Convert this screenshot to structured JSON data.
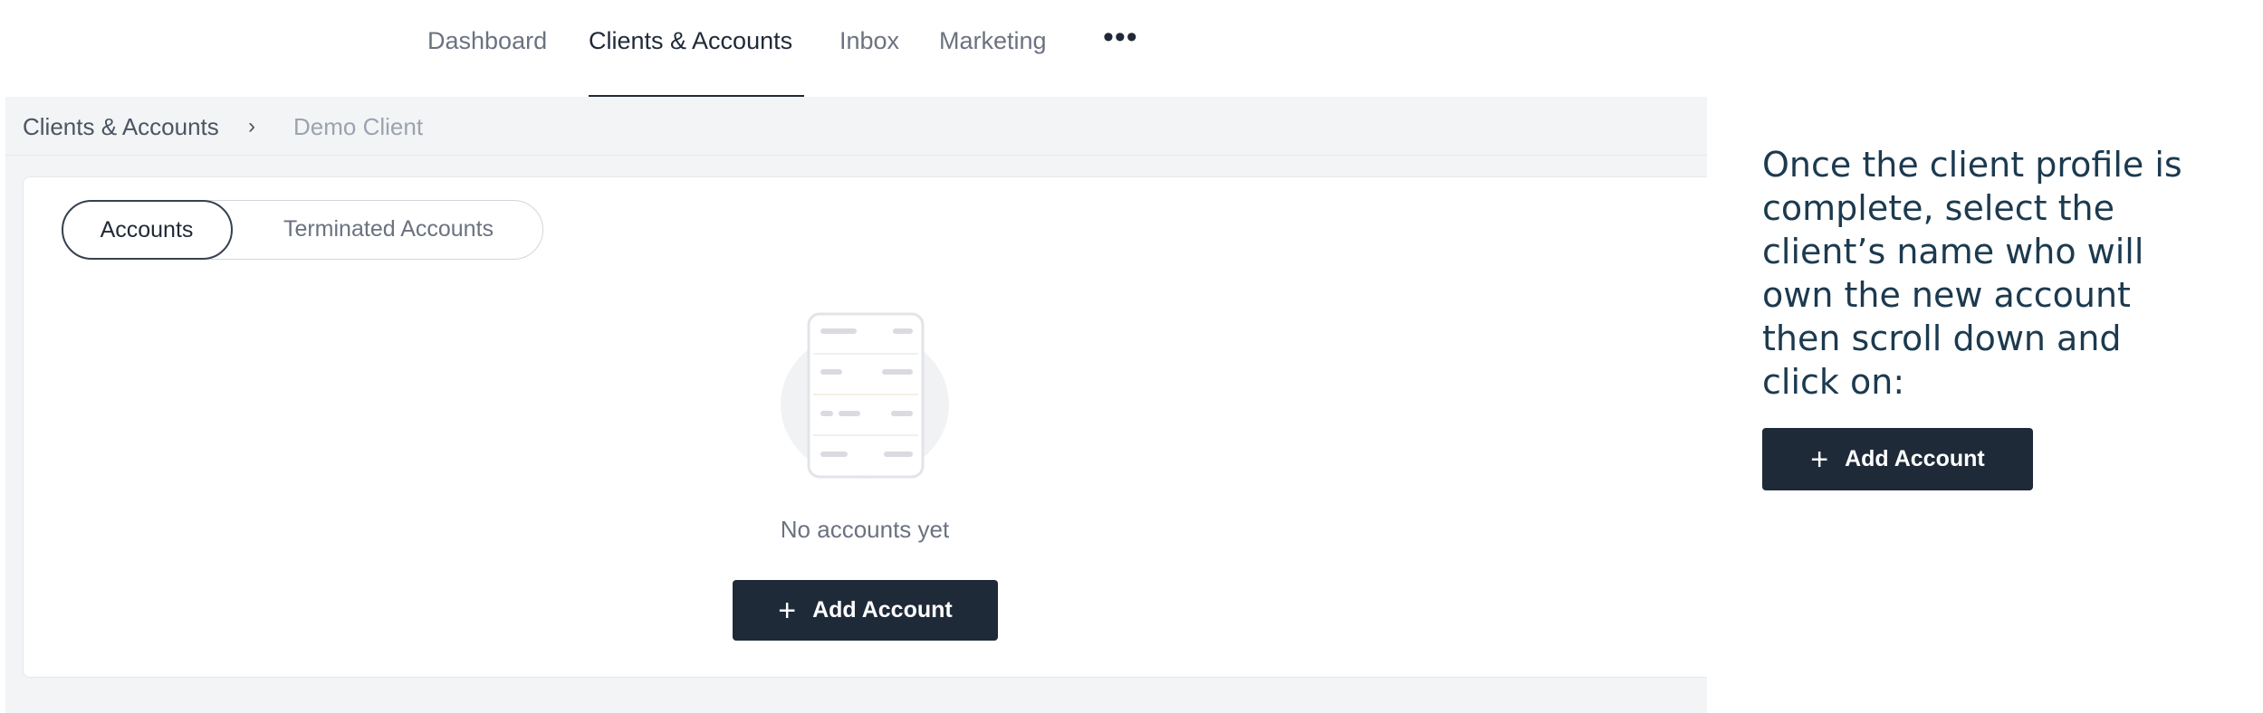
{
  "nav": {
    "tabs": [
      {
        "label": "Dashboard"
      },
      {
        "label": "Clients & Accounts"
      },
      {
        "label": "Inbox"
      },
      {
        "label": "Marketing"
      }
    ],
    "more_label": "•••"
  },
  "breadcrumb": {
    "parent": "Clients & Accounts",
    "separator": "›",
    "current": "Demo Client"
  },
  "account_tabs": {
    "active": "Accounts",
    "inactive": "Terminated Accounts"
  },
  "empty_state": {
    "message": "No accounts yet",
    "illustration_icon": "document-list-illustration"
  },
  "add_account_button": {
    "icon": "+",
    "label": "Add Account"
  },
  "instruction": {
    "text": "Once the client profile is complete, select the client’s name who will own the new account then scroll down and click on:"
  },
  "instruction_button": {
    "icon": "+",
    "label": "Add Account"
  },
  "colors": {
    "button_bg": "#1e2a38",
    "instruction_text": "#1c3a4f",
    "active_tab": "#1f2937",
    "muted": "#6b7280"
  }
}
